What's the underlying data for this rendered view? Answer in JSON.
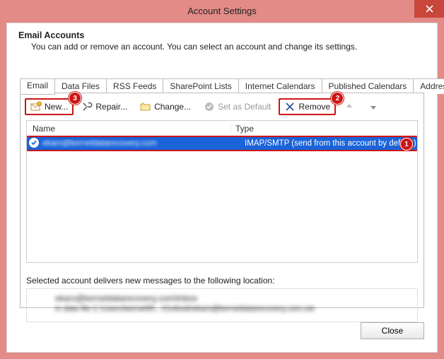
{
  "window": {
    "title": "Account Settings"
  },
  "header": {
    "title": "Email Accounts",
    "subtitle": "You can add or remove an account. You can select an account and change its settings."
  },
  "tabs": [
    {
      "label": "Email",
      "active": true
    },
    {
      "label": "Data Files"
    },
    {
      "label": "RSS Feeds"
    },
    {
      "label": "SharePoint Lists"
    },
    {
      "label": "Internet Calendars"
    },
    {
      "label": "Published Calendars"
    },
    {
      "label": "Address Books"
    }
  ],
  "toolbar": {
    "new_label": "New...",
    "repair_label": "Repair...",
    "change_label": "Change...",
    "setdefault_label": "Set as Default",
    "remove_label": "Remove"
  },
  "annotations": {
    "new": "3",
    "remove": "2",
    "row": "1"
  },
  "columns": {
    "name": "Name",
    "type": "Type"
  },
  "accounts": [
    {
      "name": "ekars@kerneldatarecovery.com",
      "type": "IMAP/SMTP (send from this account by default)",
      "selected": true,
      "default": true
    }
  ],
  "delivery": {
    "text": "Selected account delivers new messages to the following location:",
    "line1": "ekars@kerneldatarecovery.com\\Inbox",
    "line2": "in data file C:\\Users\\kernel95...\\Outlook\\ekars@kerneldatarecovery.com.ost"
  },
  "footer": {
    "close_label": "Close"
  }
}
